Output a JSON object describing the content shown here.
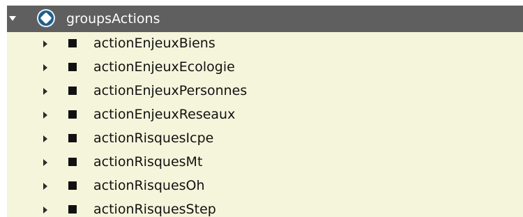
{
  "tree": {
    "group": {
      "label": "groupsActions",
      "icon": "group-icon",
      "expanded": true
    },
    "items": [
      {
        "label": "actionEnjeuxBiens",
        "icon": "square-icon"
      },
      {
        "label": "actionEnjeuxEcologie",
        "icon": "square-icon"
      },
      {
        "label": "actionEnjeuxPersonnes",
        "icon": "square-icon"
      },
      {
        "label": "actionEnjeuxReseaux",
        "icon": "square-icon"
      },
      {
        "label": "actionRisquesIcpe",
        "icon": "square-icon"
      },
      {
        "label": "actionRisquesMt",
        "icon": "square-icon"
      },
      {
        "label": "actionRisquesOh",
        "icon": "square-icon"
      },
      {
        "label": "actionRisquesStep",
        "icon": "square-icon"
      }
    ]
  },
  "colors": {
    "panel": "#f5f5dc",
    "header": "#5f5f5f",
    "text": "#111111",
    "group_icon": "#1f5f8b"
  }
}
